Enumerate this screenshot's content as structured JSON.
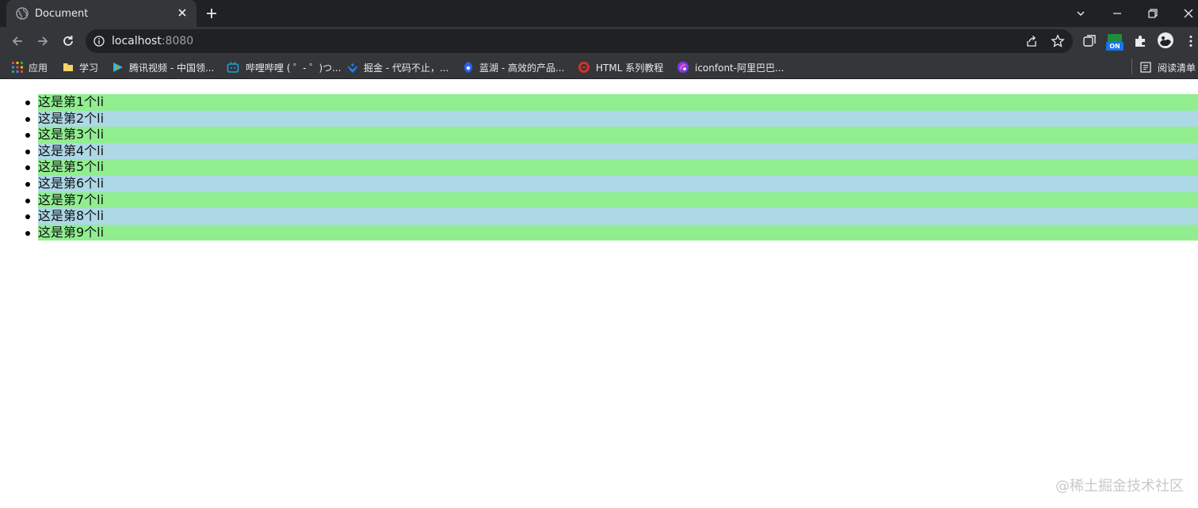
{
  "browser": {
    "tab_title": "Document",
    "url_host": "localhost",
    "url_port": ":8080",
    "ext_badge": "ON"
  },
  "bookmarks": [
    {
      "icon": "apps-grid-icon",
      "label": "应用"
    },
    {
      "icon": "folder-icon",
      "label": "学习"
    },
    {
      "icon": "tencent-video-icon",
      "label": "腾讯视频 - 中国领..."
    },
    {
      "icon": "bilibili-icon",
      "label": "哔哩哔哩 ( ゜- ゜)つ..."
    },
    {
      "icon": "juejin-icon",
      "label": "掘金 - 代码不止，..."
    },
    {
      "icon": "lanhu-icon",
      "label": "蓝湖 - 高效的产品..."
    },
    {
      "icon": "html-tutorial-icon",
      "label": "HTML 系列教程"
    },
    {
      "icon": "iconfont-icon",
      "label": "iconfont-阿里巴巴..."
    }
  ],
  "reading_list": "阅读清单",
  "list_items": [
    "这是第1个li",
    "这是第2个li",
    "这是第3个li",
    "这是第4个li",
    "这是第5个li",
    "这是第6个li",
    "这是第7个li",
    "这是第8个li",
    "这是第9个li"
  ],
  "colors": {
    "odd_row": "#90ee90",
    "even_row": "#add8e6",
    "chrome_dark": "#202124",
    "chrome_toolbar": "#35363a"
  },
  "watermark": "@稀土掘金技术社区"
}
